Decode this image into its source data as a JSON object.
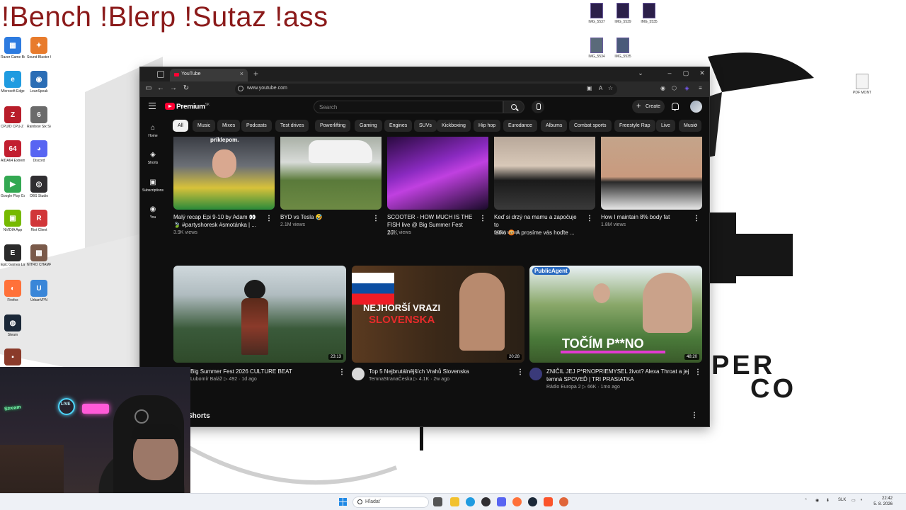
{
  "overlay_title": "!Bench !Blerp !Sutaz !ass",
  "desktop": {
    "icons": [
      {
        "label": "Razer Game Booster",
        "color": "#2d7be0",
        "glyph": "▦"
      },
      {
        "label": "Sound Blaster Connect 2",
        "color": "#e87b2c",
        "glyph": "✦"
      },
      {
        "label": "Microsoft Edge",
        "color": "#1f9be0",
        "glyph": "e"
      },
      {
        "label": "LeanSpeak",
        "color": "#2a6db5",
        "glyph": "◉"
      },
      {
        "label": "CPUID CPU-Z MSI",
        "color": "#b81d2a",
        "glyph": "Z"
      },
      {
        "label": "Rainbow Six Siege",
        "color": "#6b6b6b",
        "glyph": "6"
      },
      {
        "label": "AIDA64 Extreme",
        "color": "#c21f30",
        "glyph": "64"
      },
      {
        "label": "Discord",
        "color": "#5865f2",
        "glyph": "◕"
      },
      {
        "label": "Google Play Games",
        "color": "#33a852",
        "glyph": "▶"
      },
      {
        "label": "OBS Studio",
        "color": "#302e31",
        "glyph": "◎"
      },
      {
        "label": "NVIDIA App",
        "color": "#76b900",
        "glyph": "▣"
      },
      {
        "label": "Riot Client",
        "color": "#d13639",
        "glyph": "R"
      },
      {
        "label": "Epic Games Launcher",
        "color": "#2a2a2a",
        "glyph": "E"
      },
      {
        "label": "NITRO CHAMPI...",
        "color": "#7a5a4a",
        "glyph": "▩"
      },
      {
        "label": "Firefox",
        "color": "#ff7139",
        "glyph": "◐"
      },
      {
        "label": "UrbanVPN",
        "color": "#3a86d8",
        "glyph": "U"
      },
      {
        "label": "Steam",
        "color": "#1b2838",
        "glyph": "◍"
      },
      {
        "label": "",
        "color": "#8a3a2a",
        "glyph": "▪"
      }
    ],
    "files": [
      "IMG_5537",
      "IMG_5539",
      "IMG_5535",
      "IMG_5534",
      "IMG_5535",
      "PDF MONT"
    ],
    "wallpaper_text_1": "PER",
    "wallpaper_text_2": "CO"
  },
  "browser": {
    "tab_title": "YouTube",
    "url": "www.youtube.com",
    "window_controls": [
      "–",
      "▢",
      "✕"
    ]
  },
  "youtube": {
    "brand": "Premium",
    "brand_region": "SK",
    "search_placeholder": "Search",
    "create_label": "Create",
    "rail": [
      {
        "label": "Home",
        "icon": "home-icon",
        "glyph": "⌂"
      },
      {
        "label": "Shorts",
        "icon": "shorts-icon",
        "glyph": "◈"
      },
      {
        "label": "Subscriptions",
        "icon": "subscriptions-icon",
        "glyph": "▣"
      },
      {
        "label": "You",
        "icon": "you-icon",
        "glyph": "◉"
      }
    ],
    "chips": [
      "All",
      "Music",
      "Mixes",
      "Podcasts",
      "Test drives",
      "Powerlifting",
      "Gaming",
      "Engines",
      "SUVs",
      "Kickboxing",
      "Hip hop",
      "Eurodance",
      "Albums",
      "Combat sports",
      "Freestyle Rap",
      "Live",
      "Music"
    ],
    "row1": [
      {
        "title1": "Malý recap Epi 9-10 by Adam 👀",
        "title2": "🍃 #partyshoresk #smotánka | ...",
        "meta": "3.9K views",
        "thumb_text": "príklepom."
      },
      {
        "title1": "BYD vs Tesla 🤣",
        "title2": "",
        "meta": "2.1M views",
        "thumb_text": ""
      },
      {
        "title1": "SCOOTER - HOW MUCH IS THE",
        "title2": "FISH live @ Big Summer Fest 20...",
        "meta": "1.7K views",
        "thumb_text": ""
      },
      {
        "title1": "Keď si drzý na mamu a započuje to",
        "title2": "tatko 😡 A prosíme vás hoďte ...",
        "meta": "205K views",
        "thumb_text": ""
      },
      {
        "title1": "How I maintain 8% body fat",
        "title2": "",
        "meta": "1.8M views",
        "thumb_text": ""
      }
    ],
    "row2": [
      {
        "title1": "Big Summer Fest 2026 CULTURE BEAT",
        "title2": "",
        "channel": "Lubomír Baláž",
        "views": "492",
        "age": "1d ago",
        "duration": "23:13",
        "thumb_text": ""
      },
      {
        "title1": "Top 5 Nejbrutálnějších Vrahů Slovenska",
        "title2": "",
        "channel": "TemnaStranaČeska",
        "views": "4.1K",
        "age": "2w ago",
        "duration": "20:28",
        "thumb_text": "NEJHORŠÍ VRAZI",
        "thumb_text2": "SLOVENSKA"
      },
      {
        "title1": "ZNIČIL JEJ P*RNOPRIEMYSEL život? Alexa Throat a jej",
        "title2": "temná SPOVEĎ | TRI PRASIATKA",
        "channel": "Rádio Europa 2",
        "views": "66K",
        "age": "1mo ago",
        "duration": "48:20",
        "thumb_text": "TOČÍM P**NO",
        "thumb_badge": "PublicAgent"
      }
    ],
    "shorts_heading": "Shorts"
  },
  "webcam": {
    "sign_left": "Stream",
    "sign_mid": "LIVE"
  },
  "taskbar": {
    "search_placeholder": "Hľadať",
    "tray_lang": "SLK",
    "time": "22:42",
    "date": "5. 8. 2026"
  }
}
